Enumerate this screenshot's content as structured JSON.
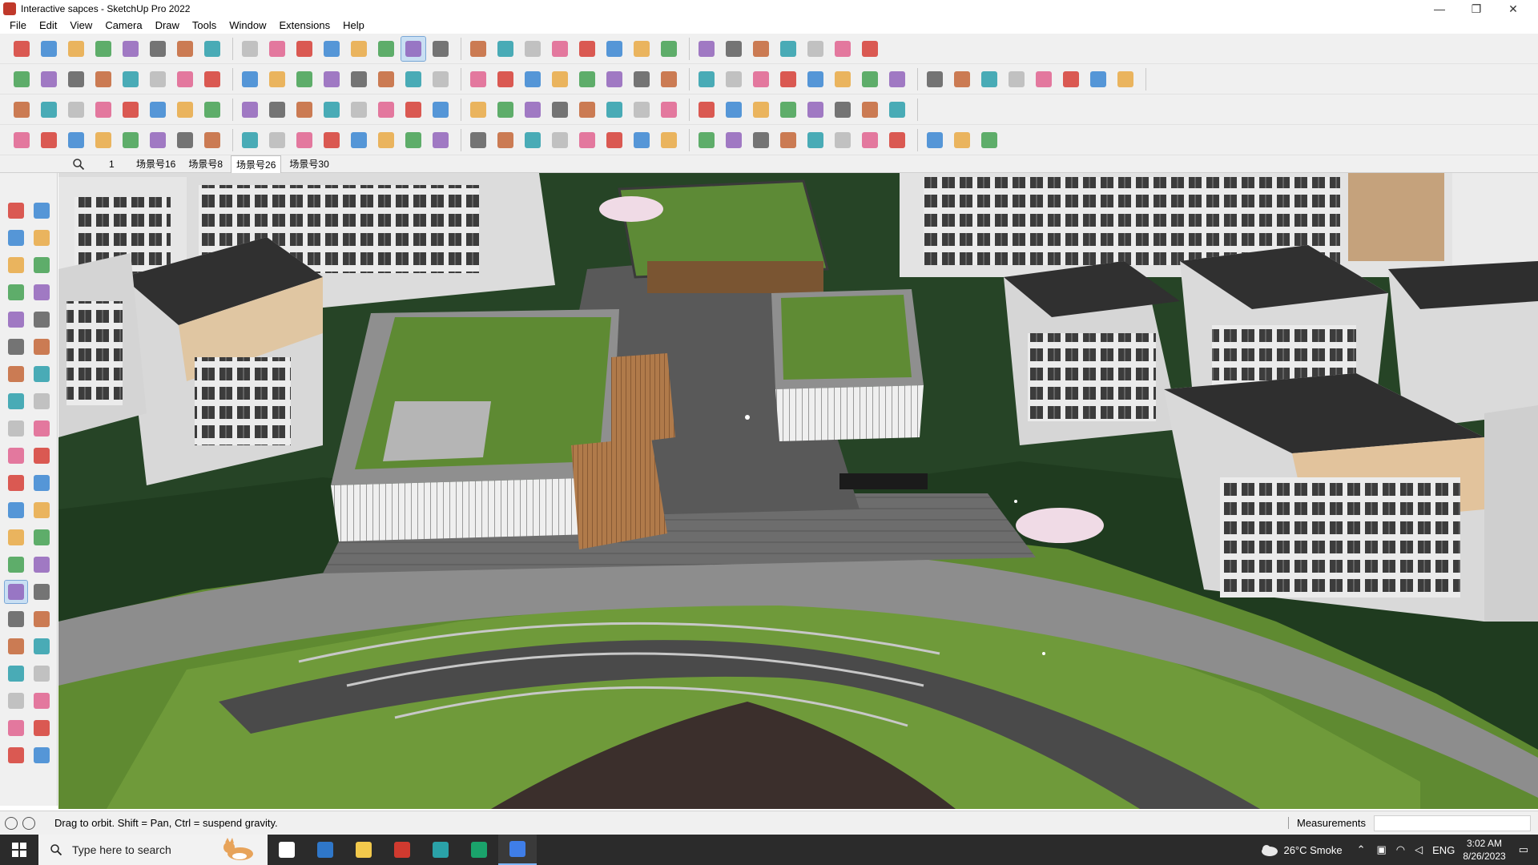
{
  "window": {
    "title": "Interactive sapces - SketchUp Pro 2022",
    "controls": {
      "minimize": "—",
      "maximize": "❐",
      "close": "✕"
    }
  },
  "menu": [
    "File",
    "Edit",
    "View",
    "Camera",
    "Draw",
    "Tools",
    "Window",
    "Extensions",
    "Help"
  ],
  "toolbars": {
    "row1": [
      "zoom-extents-icon",
      "select-icon",
      "eraser-icon",
      "pencil-icon",
      "lasso-icon",
      "paint-icon",
      "push-pull-icon",
      "follow-me-icon",
      "move-icon",
      "rotate-icon",
      "scale-icon",
      "tape-icon",
      "text-icon",
      "paint-bucket-icon",
      "orbit-icon",
      "pan-icon",
      "zoom-icon",
      "zoom-window-icon",
      "position-camera-icon",
      "walk-icon",
      "look-around-icon",
      "section-icon",
      "profile-icon",
      "sandbox-icon",
      "warehouse-icon",
      "extension-icon",
      "layer-icon",
      "tag-icon",
      "undo-icon",
      "redo-icon",
      "trim-icon"
    ],
    "row2": [
      "iso-view-icon",
      "top-view-icon",
      "front-view-icon",
      "right-view-icon",
      "back-view-icon",
      "left-view-icon",
      "bottom-view-icon",
      "xray-icon",
      "back-edges-icon",
      "wireframe-icon",
      "hidden-line-icon",
      "shaded-icon",
      "textured-icon",
      "monochrome-icon",
      "house-icon",
      "component-icon",
      "group-icon",
      "solid-union-icon",
      "solid-subtract-icon",
      "solid-trim-icon",
      "solid-split-icon",
      "intersect-icon",
      "outer-shell-icon",
      "shape-icon",
      "circle-icon",
      "polygon-icon",
      "ellipse-icon",
      "arc-icon",
      "curve-icon",
      "curve-tool-icon",
      "spline-icon",
      "bezier-icon",
      "red-line-icon",
      "pink-icon",
      "wood-icon",
      "door-icon",
      "window-icon",
      "stair-icon",
      "fence-icon",
      "roof-icon"
    ],
    "row3": [
      "face-icon",
      "extrude-icon",
      "offset-icon",
      "bend-icon",
      "fillet-icon",
      "chamfer-icon",
      "array-icon",
      "copy-icon",
      "move-plus-icon",
      "align-icon",
      "mirror-icon",
      "flip-icon",
      "explode-icon",
      "weld-icon",
      "join-icon",
      "split-icon",
      "node-icon",
      "vertex-icon",
      "smooth-icon",
      "subdivide-icon",
      "loop-icon",
      "quad-icon",
      "tile-icon",
      "grid-icon",
      "frame-icon",
      "mesh-icon",
      "terrain-icon",
      "brick-icon",
      "tiles-icon",
      "tile2-icon",
      "cube-grid-icon",
      "dots-icon"
    ],
    "row4": [
      "draw-line-icon",
      "freehand-icon",
      "paint2-icon",
      "rectangle-rotated-icon",
      "circle2-icon",
      "ring-icon",
      "arc2-icon",
      "pie-icon",
      "angle-icon",
      "line-angle-icon",
      "line2-icon",
      "curve2-icon",
      "building-icon",
      "cone-icon",
      "column-icon",
      "pillar-icon",
      "hand-icon",
      "leaf-icon",
      "plane-icon",
      "stack-icon",
      "stripe-icon",
      "wave-icon",
      "cable-icon",
      "bridge-icon",
      "stripes2-icon",
      "wall-icon",
      "gate-icon",
      "fence2-icon",
      "grid2-icon",
      "pattern-icon",
      "barrier-icon",
      "wheel-icon",
      "gear-icon",
      "ripple-icon",
      "star-icon"
    ]
  },
  "scenes": {
    "first": "1",
    "tabs": [
      "场景号16",
      "场景号8",
      "场景号26",
      "场景号30"
    ],
    "active_index": 2
  },
  "left_toolbar": [
    [
      "select-icon",
      "orbit-icon"
    ],
    [
      "paint-bucket-icon",
      "eraser-icon"
    ],
    [
      "component-icon",
      "tag-icon"
    ],
    [
      "line-icon",
      "freehand-icon"
    ],
    [
      "rectangle-icon",
      "rotated-rectangle-icon"
    ],
    [
      "circle-icon",
      "polygon-icon"
    ],
    [
      "arc-icon",
      "two-point-arc-icon"
    ],
    [
      "three-point-arc-icon",
      "pie-icon"
    ],
    [
      "move-icon",
      "push-pull-icon"
    ],
    [
      "rotate-icon",
      "follow-me-icon"
    ],
    [
      "scale-icon",
      "offset-icon"
    ],
    [
      "tape-measure-icon",
      "dimension-icon"
    ],
    [
      "protractor-icon",
      "text-icon"
    ],
    [
      "axes-icon",
      "3d-text-icon"
    ],
    [
      "orbit-active-icon",
      "pan-icon"
    ],
    [
      "zoom-icon",
      "zoom-window-icon"
    ],
    [
      "zoom-extents-icon",
      "previous-view-icon"
    ],
    [
      "position-camera-icon",
      "look-around-icon"
    ],
    [
      "walk-icon",
      "section-plane-icon"
    ],
    [
      "display-section-icon",
      "section-cuts-icon"
    ],
    [
      "section-fill-icon",
      "sandbox-icon"
    ]
  ],
  "status": {
    "hint": "Drag to orbit. Shift = Pan, Ctrl = suspend gravity.",
    "measurements_label": "Measurements",
    "measurements_value": ""
  },
  "taskbar": {
    "search_placeholder": "Type here to search",
    "apps": [
      "task-view-icon",
      "calculator-icon",
      "file-explorer-icon",
      "acrobat-icon",
      "app-s-icon",
      "edge-icon",
      "sketchup-icon"
    ],
    "weather": "26°C  Smoke",
    "language": "ENG",
    "time": "3:02 AM",
    "date": "8/26/2023"
  },
  "colors": {
    "accent_blue": "#7aa7d6",
    "viewport_grass": "#587a2c",
    "viewport_dark_grass": "#1f3b1f",
    "taskbar_bg": "#2b2b2b"
  }
}
